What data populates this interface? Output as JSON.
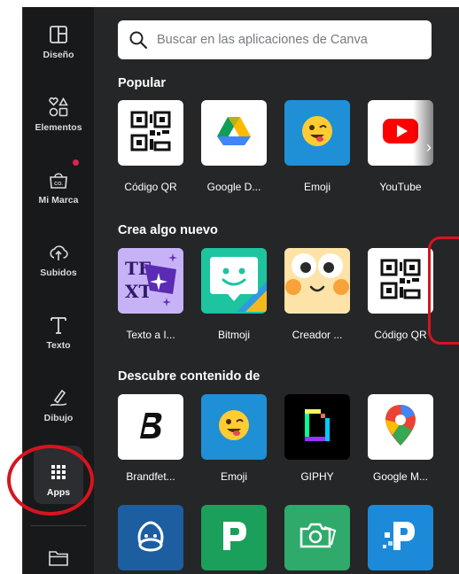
{
  "sidebar": {
    "items": [
      {
        "label": "Diseño",
        "icon": "layout-icon"
      },
      {
        "label": "Elementos",
        "icon": "elements-icon"
      },
      {
        "label": "Mi Marca",
        "icon": "brand-icon"
      },
      {
        "label": "Subidos",
        "icon": "upload-cloud-icon"
      },
      {
        "label": "Texto",
        "icon": "text-icon"
      },
      {
        "label": "Dibujo",
        "icon": "draw-icon"
      },
      {
        "label": "Apps",
        "icon": "apps-grid-icon"
      }
    ],
    "active": "Apps"
  },
  "search": {
    "placeholder": "Buscar en las aplicaciones de Canva"
  },
  "sections": {
    "popular": {
      "title": "Popular",
      "apps": [
        "Código QR",
        "Google D...",
        "Emoji",
        "YouTube"
      ]
    },
    "create": {
      "title": "Crea algo nuevo",
      "apps": [
        "Texto a I...",
        "Bitmoji",
        "Creador ...",
        "Código QR"
      ]
    },
    "discover": {
      "title": "Descubre contenido de",
      "apps": [
        "Brandfet...",
        "Emoji",
        "GIPHY",
        "Google M..."
      ]
    }
  },
  "colors": {
    "sidebar_bg": "#18191b",
    "panel_bg": "#252627",
    "highlight": "#d7141f",
    "notification": "#e0234e"
  }
}
